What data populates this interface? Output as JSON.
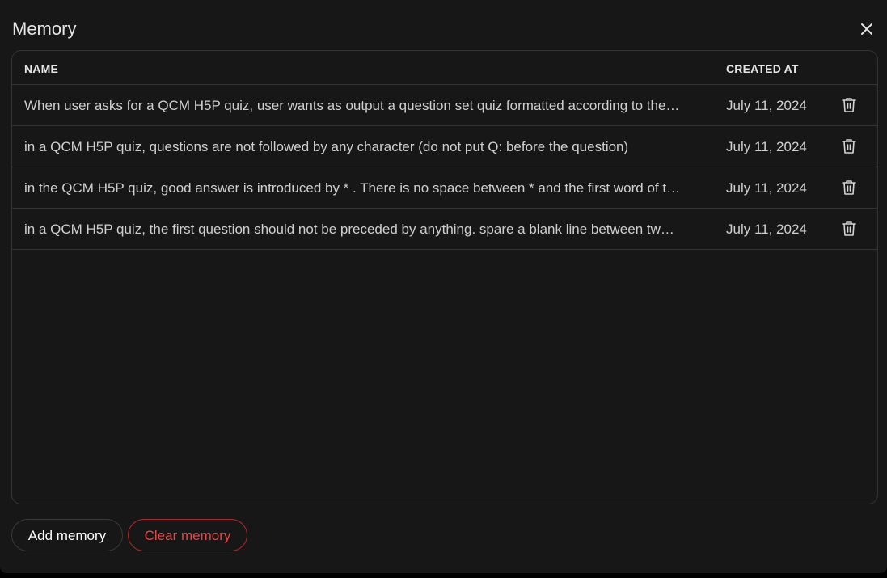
{
  "modal": {
    "title": "Memory"
  },
  "table": {
    "headers": {
      "name": "NAME",
      "created_at": "CREATED AT"
    },
    "rows": [
      {
        "name": "When user asks for a QCM H5P quiz, user wants as output a question set quiz formatted according to the…",
        "created_at": "July 11, 2024"
      },
      {
        "name": "in a QCM H5P quiz, questions are not followed by any character (do not put Q: before the question)",
        "created_at": "July 11, 2024"
      },
      {
        "name": "in the QCM H5P quiz, good answer is introduced by * . There is no space between * and the first word of t…",
        "created_at": "July 11, 2024"
      },
      {
        "name": "in a QCM H5P quiz, the first question should not be preceded by anything. spare a blank line between tw…",
        "created_at": "July 11, 2024"
      }
    ]
  },
  "footer": {
    "add_label": "Add memory",
    "clear_label": "Clear memory"
  },
  "icons": {
    "close": "close-icon",
    "delete": "trash-icon"
  },
  "colors": {
    "background": "#171717",
    "danger": "#ef4444",
    "border": "#333333"
  }
}
